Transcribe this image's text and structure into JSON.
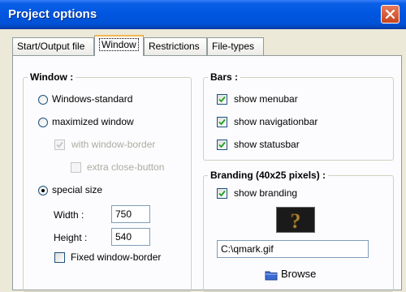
{
  "window": {
    "title": "Project options"
  },
  "tabs": [
    {
      "label": "Start/Output file"
    },
    {
      "label": "Window"
    },
    {
      "label": "Restrictions"
    },
    {
      "label": "File-types"
    }
  ],
  "window_group": {
    "title": "Window :",
    "options": {
      "windows_standard": "Windows-standard",
      "maximized": "maximized window",
      "with_border": "with window-border",
      "extra_close": "extra close-button",
      "special_size": "special size"
    },
    "width_label": "Width :",
    "width_value": "750",
    "height_label": "Height :",
    "height_value": "540",
    "fixed_border": "Fixed window-border"
  },
  "bars_group": {
    "title": "Bars :",
    "menubar": "show menubar",
    "navigationbar": "show navigationbar",
    "statusbar": "show statusbar"
  },
  "branding_group": {
    "title": "Branding (40x25 pixels) :",
    "show_branding": "show branding",
    "file_value": "C:\\qmark.gif",
    "browse_label": "Browse",
    "image_icon": "question-mark-icon",
    "browse_icon": "browse-icon"
  },
  "colors": {
    "titlebar": "#0056e0",
    "tab_highlight": "#f3b84f",
    "checkmark": "#21a121"
  }
}
